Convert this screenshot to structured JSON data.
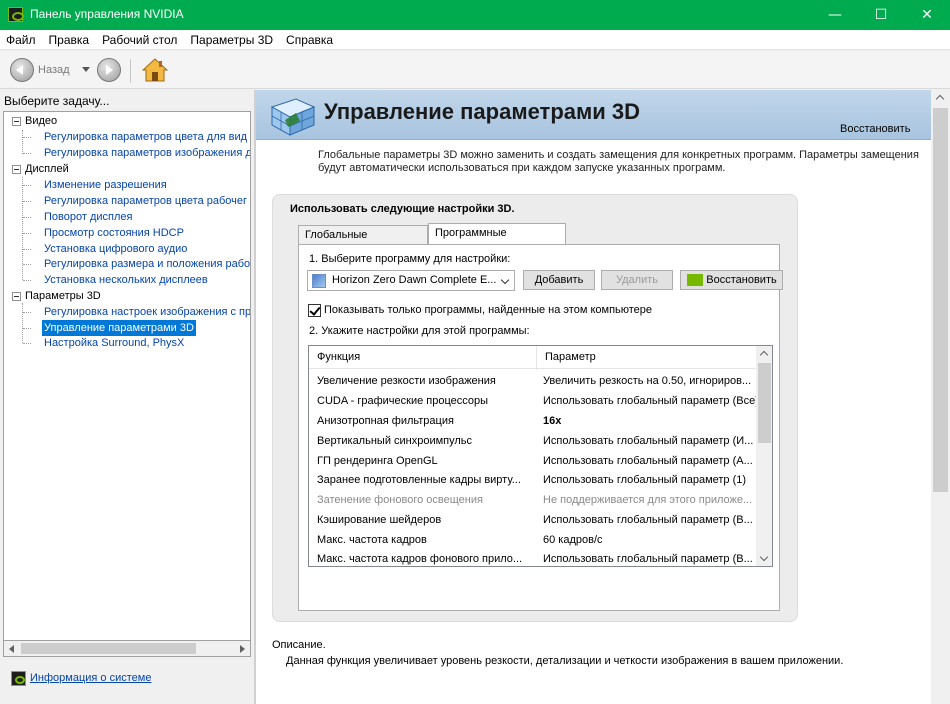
{
  "window": {
    "title": "Панель управления NVIDIA",
    "minimize_glyph": "—",
    "maximize_glyph": "☐",
    "close_glyph": "✕"
  },
  "menu": [
    "Файл",
    "Правка",
    "Рабочий стол",
    "Параметры 3D",
    "Справка"
  ],
  "toolbar": {
    "back_label": "Назад"
  },
  "sidebar": {
    "caption": "Выберите задачу...",
    "groups": [
      {
        "label": "Видео",
        "items": [
          "Регулировка параметров цвета для вид",
          "Регулировка параметров изображения д"
        ]
      },
      {
        "label": "Дисплей",
        "items": [
          "Изменение разрешения",
          "Регулировка параметров цвета рабочег",
          "Поворот дисплея",
          "Просмотр состояния HDCP",
          "Установка цифрового аудио",
          "Регулировка размера и положения рабо",
          "Установка нескольких дисплеев"
        ]
      },
      {
        "label": "Параметры 3D",
        "items": [
          "Регулировка настроек изображения с пр",
          "Управление параметрами 3D",
          "Настройка Surround, PhysX"
        ]
      }
    ],
    "selected_item": "Управление параметрами 3D",
    "system_info_link": "Информация о системе"
  },
  "main": {
    "title": "Управление параметрами 3D",
    "restore_link": "Восстановить",
    "intro": "Глобальные параметры 3D можно заменить и создать замещения для конкретных программ. Параметры замещения будут автоматически использоваться при каждом запуске указанных программ.",
    "settings_heading": "Использовать следующие настройки 3D.",
    "tabs": [
      {
        "label": "Глобальные параметры",
        "active": false
      },
      {
        "label": "Программные настройки",
        "active": true
      }
    ],
    "step1_label": "1. Выберите программу для настройки:",
    "selected_program": "Horizon Zero Dawn Complete E...",
    "buttons": {
      "add": "Добавить",
      "remove": "Удалить",
      "restore": "Восстановить"
    },
    "show_only_found": {
      "label": "Показывать только программы, найденные на этом компьютере",
      "checked": true
    },
    "step2_label": "2. Укажите настройки для этой программы:",
    "table": {
      "headers": [
        "Функция",
        "Параметр"
      ],
      "rows": [
        {
          "function": "Увеличение резкости изображения",
          "value": "Увеличить резкость на 0.50, игнориров...",
          "style": "normal"
        },
        {
          "function": "CUDA - графические процессоры",
          "value": "Использовать глобальный параметр (Все)",
          "style": "normal"
        },
        {
          "function": "Анизотропная фильтрация",
          "value": "16x",
          "style": "bold"
        },
        {
          "function": "Вертикальный синхроимпульс",
          "value": "Использовать глобальный параметр (И...",
          "style": "normal"
        },
        {
          "function": "ГП рендеринга OpenGL",
          "value": "Использовать глобальный параметр (А...",
          "style": "normal"
        },
        {
          "function": "Заранее подготовленные кадры вирту...",
          "value": "Использовать глобальный параметр (1)",
          "style": "normal"
        },
        {
          "function": "Затенение фонового освещения",
          "value": "Не поддерживается для этого приложе...",
          "style": "dim"
        },
        {
          "function": "Кэширование шейдеров",
          "value": "Использовать глобальный параметр (В...",
          "style": "normal"
        },
        {
          "function": "Макс. частота кадров",
          "value": "60 кадров/с",
          "style": "normal"
        },
        {
          "function": "Макс. частота кадров фонового прило...",
          "value": "Использовать глобальный параметр (В...",
          "style": "normal"
        }
      ]
    },
    "description_title": "Описание.",
    "description_text": "Данная функция увеличивает уровень резкости, детализации и четкости изображения в вашем приложении."
  },
  "colors": {
    "titlebar": "#00aa4e",
    "nvidia_green": "#76b900",
    "selection": "#0078d7",
    "link": "#0645ad",
    "banner": "#b4cde6"
  }
}
